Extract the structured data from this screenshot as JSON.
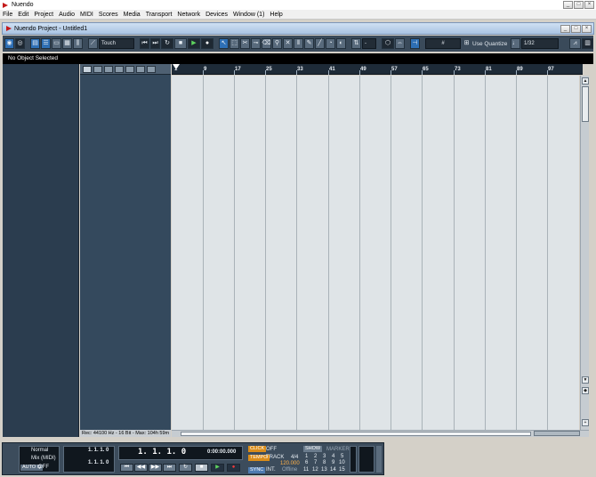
{
  "app": {
    "title": "Nuendo"
  },
  "window_controls": {
    "minimize": "_",
    "maximize": "□",
    "close": "×"
  },
  "menu": [
    "File",
    "Edit",
    "Project",
    "Audio",
    "MIDI",
    "Scores",
    "Media",
    "Transport",
    "Network",
    "Devices",
    "Window (1)",
    "Help"
  ],
  "project_window": {
    "title": "Nuendo Project - Untitled1"
  },
  "toolbar": {
    "automation_mode": "Touch",
    "nudge_value": "-",
    "grid_type": "Use Quantize",
    "quantize_value": "1/32"
  },
  "infoline": {
    "text": "No Object Selected"
  },
  "track_list": {
    "status": "Rec: 44100 Hz - 16 Bit - Max: 104h 59m"
  },
  "ruler": {
    "bars": [
      "1",
      "9",
      "17",
      "25",
      "33",
      "41",
      "49",
      "57",
      "65",
      "73",
      "81",
      "89",
      "97"
    ]
  },
  "transport": {
    "mode": "Normal",
    "mix_mode": "Mix (MIDI)",
    "auto_q": "AUTO Q",
    "auto_q_state": "OFF",
    "left_locator": "1. 1. 1.   0",
    "right_locator": "1. 1. 1.   0",
    "position_bars": "1. 1. 1.   0",
    "position_time": "0:00:00.000",
    "click_label": "CLICK",
    "click_state": "OFF",
    "tempo_label": "TEMPO",
    "tempo_mode": "TRACK",
    "signature": "4/4",
    "tempo_value": "120.000",
    "sync_label": "SYNC",
    "sync_mode": "INT.",
    "sync_state": "Offline",
    "show_label": "SHOW",
    "marker_label": "MARKER",
    "markers_row1": [
      "1",
      "2",
      "3",
      "4",
      "5"
    ],
    "markers_row2": [
      "6",
      "7",
      "8",
      "9",
      "10"
    ],
    "markers_row3": [
      "11",
      "12",
      "13",
      "14",
      "15"
    ]
  }
}
